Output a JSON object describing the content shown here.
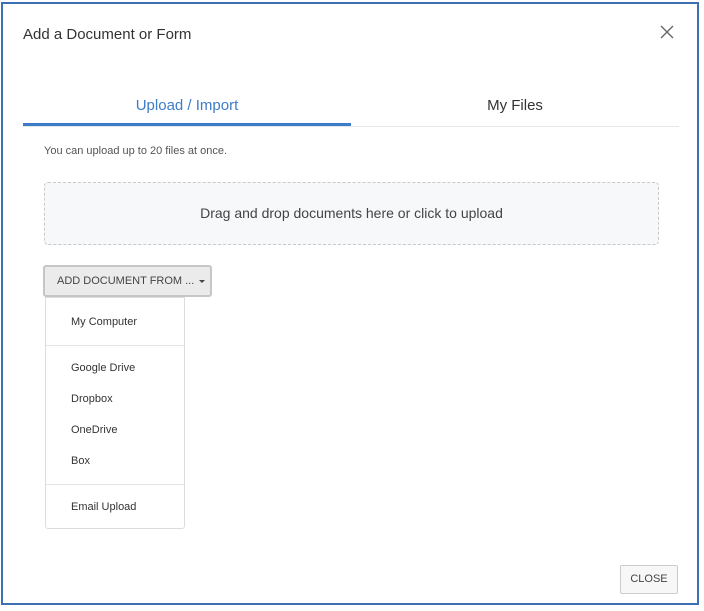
{
  "dialog": {
    "title": "Add a Document or Form",
    "close_icon": "close-icon"
  },
  "tabs": [
    {
      "label": "Upload / Import",
      "active": true
    },
    {
      "label": "My Files",
      "active": false
    }
  ],
  "upload": {
    "hint": "You can upload up to 20 files at once.",
    "dropzone_text": "Drag and drop documents here or click to upload",
    "add_button_label": "ADD DOCUMENT FROM ...",
    "add_button_icon": "caret-down-icon"
  },
  "menu": {
    "items": [
      {
        "label": "My Computer"
      },
      {
        "label": "Google Drive"
      },
      {
        "label": "Dropbox"
      },
      {
        "label": "OneDrive"
      },
      {
        "label": "Box"
      },
      {
        "label": "Email Upload"
      }
    ]
  },
  "footer": {
    "close_label": "CLOSE"
  },
  "colors": {
    "accent": "#3d7cc9",
    "frame": "#3d6fb5"
  }
}
